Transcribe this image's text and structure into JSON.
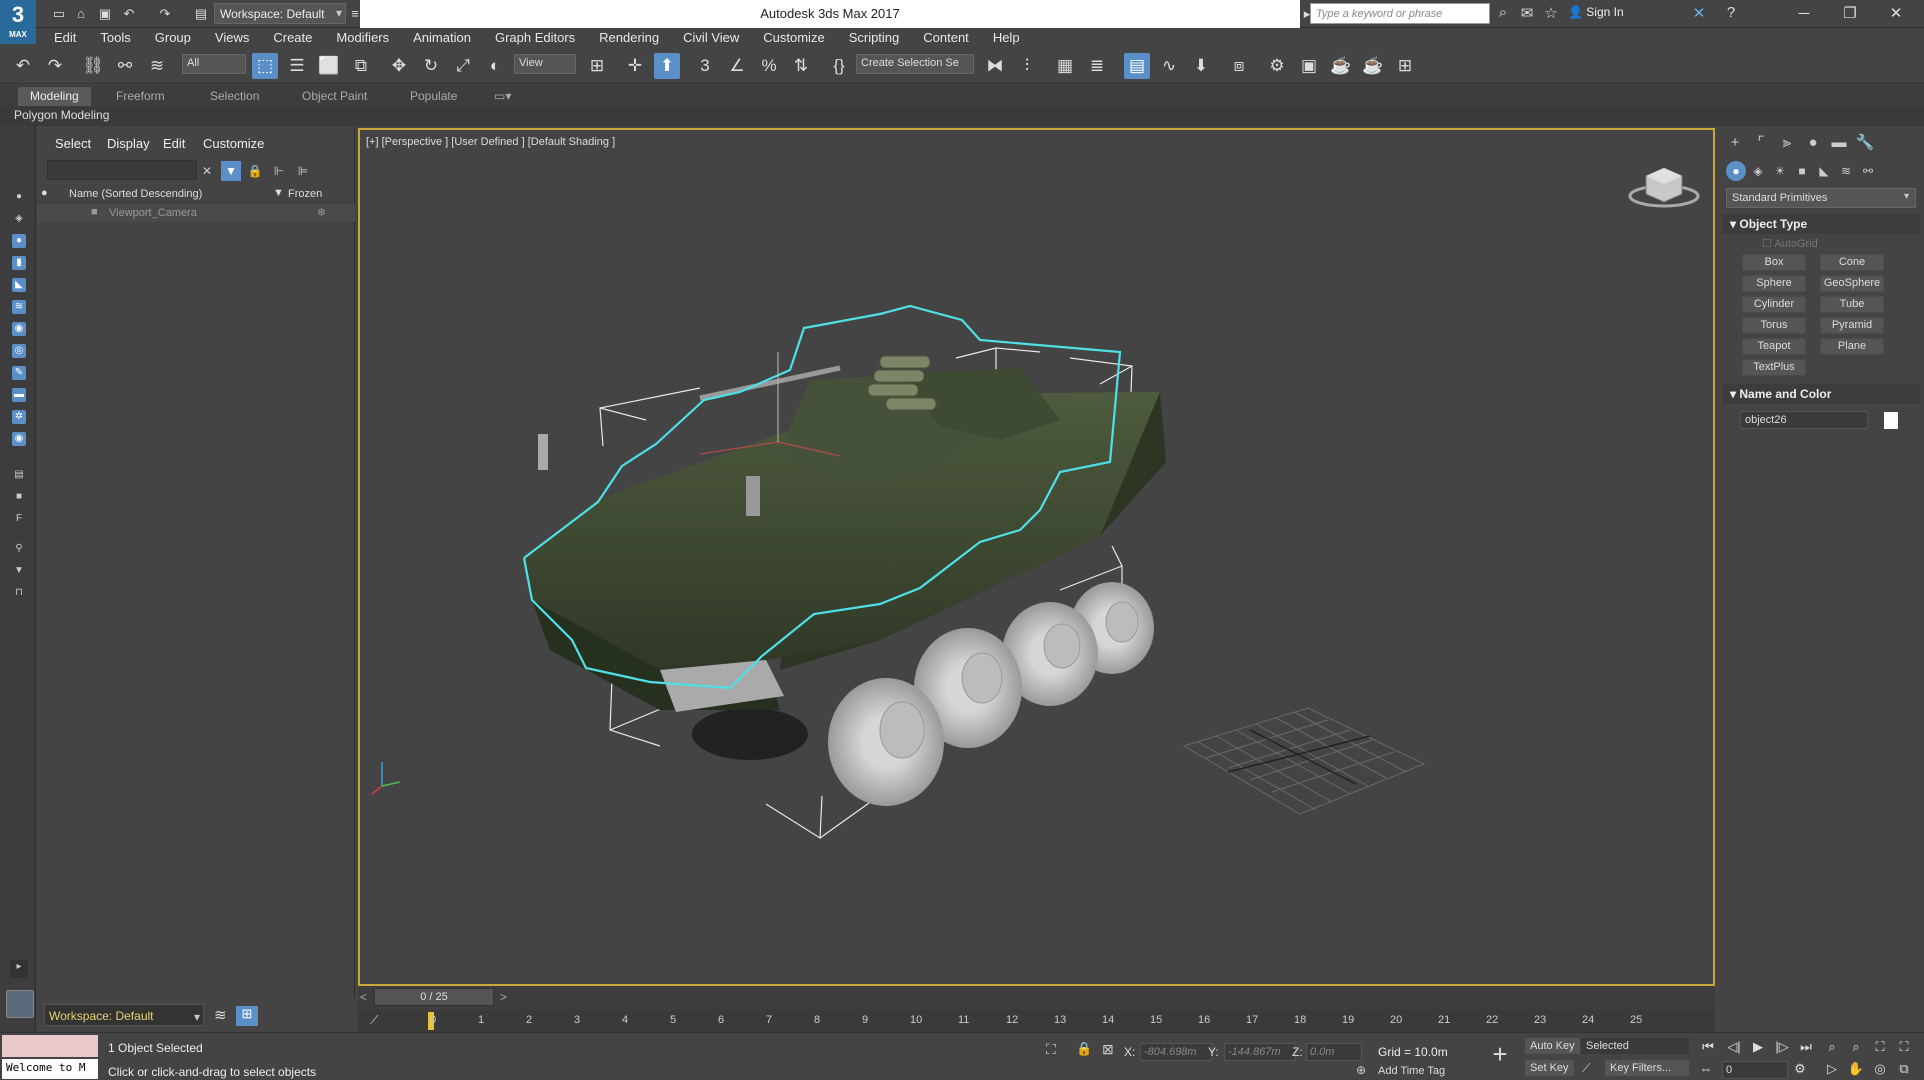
{
  "app": {
    "title": "Autodesk 3ds Max 2017",
    "logo": "3",
    "logo_sub": "MAX",
    "workspace": "Workspace: Default",
    "search_placeholder": "Type a keyword or phrase",
    "sign_in": "Sign In"
  },
  "menus": [
    "Edit",
    "Tools",
    "Group",
    "Views",
    "Create",
    "Modifiers",
    "Animation",
    "Graph Editors",
    "Rendering",
    "Civil View",
    "Customize",
    "Scripting",
    "Content",
    "Help"
  ],
  "toolbar": {
    "filter": "All",
    "ref_coord": "View",
    "selection_set": "Create Selection Se"
  },
  "ribbon": {
    "tabs": [
      "Modeling",
      "Freeform",
      "Selection",
      "Object Paint",
      "Populate"
    ],
    "active_tab": "Modeling",
    "panel": "Polygon Modeling"
  },
  "explorer": {
    "menus": [
      "Select",
      "Display",
      "Edit",
      "Customize"
    ],
    "col_name": "Name (Sorted Descending)",
    "col_frozen": "Frozen",
    "rows": [
      {
        "name": "Viewport_Camera"
      }
    ],
    "workspace": "Workspace: Default"
  },
  "viewport": {
    "label": "[+] [Perspective ] [User Defined ] [Default Shading ]"
  },
  "timeline": {
    "slider": "0 / 25",
    "ticks": [
      "0",
      "1",
      "2",
      "3",
      "4",
      "5",
      "6",
      "7",
      "8",
      "9",
      "10",
      "11",
      "12",
      "13",
      "14",
      "15",
      "16",
      "17",
      "18",
      "19",
      "20",
      "21",
      "22",
      "23",
      "24",
      "25"
    ]
  },
  "command_panel": {
    "primitives": "Standard Primitives",
    "object_type": "Object Type",
    "autogrid": "AutoGrid",
    "buttons": [
      "Box",
      "Cone",
      "Sphere",
      "GeoSphere",
      "Cylinder",
      "Tube",
      "Torus",
      "Pyramid",
      "Teapot",
      "Plane",
      "TextPlus"
    ],
    "name_and_color": "Name and Color",
    "object_name": "object26",
    "object_color": "#ffffff"
  },
  "status": {
    "selected": "1 Object Selected",
    "prompt": "Click or click-and-drag to select objects",
    "welcome": "Welcome to M",
    "x_label": "X:",
    "x": "-804.698m",
    "y_label": "Y:",
    "y": "-144.867m",
    "z_label": "Z:",
    "z": "0.0m",
    "grid": "Grid = 10.0m",
    "add_time_tag": "Add Time Tag",
    "auto_key": "Auto Key",
    "set_key": "Set Key",
    "key_mode": "Selected",
    "key_filters": "Key Filters...",
    "frame": "0"
  }
}
